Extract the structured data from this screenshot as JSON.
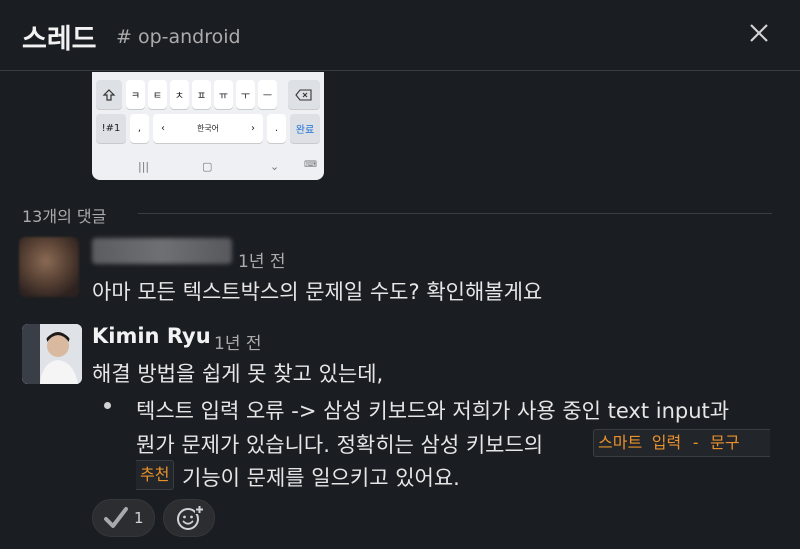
{
  "header": {
    "title": "스레드",
    "channel": "# op-android",
    "close_icon": "close-icon"
  },
  "keyboard": {
    "row1": [
      "ㅋ",
      "ㅌ",
      "ㅊ",
      "ㅍ",
      "ㅠ",
      "ㅜ",
      "ㅡ"
    ],
    "symbols_key": "!#1",
    "comma_key": ",",
    "lang_key": "한국어",
    "left_arrow": "‹",
    "right_arrow": "›",
    "period_key": ".",
    "done_key": "완료",
    "shift_icon": "shift-icon",
    "backspace_icon": "backspace-icon"
  },
  "thread": {
    "reply_count_label": "13개의 댓글"
  },
  "messages": [
    {
      "author": "",
      "time": "1년 전",
      "text": "아마 모든 텍스트박스의 문제일 수도? 확인해볼게요"
    },
    {
      "author": "Kimin Ryu",
      "time": "1년 전",
      "text": "해결 방법을 쉽게 못 찾고 있는데,",
      "bullet_line1": "텍스트 입력 오류 -> 삼성 키보드와 저희가 사용 중인 text input과",
      "bullet_line2_prefix": "뭔가 문제가 있습니다. 정확히는 삼성 키보드의",
      "code_part1": "스마트 입력 - 문구",
      "code_part2": "추천",
      "bullet_line3_suffix": "기능이 문제를 일으키고 있어요.",
      "reactions": [
        {
          "emoji_icon": "checkmark-icon",
          "count": "1"
        }
      ],
      "add_reaction_icon": "add-reaction-icon"
    }
  ],
  "colors": {
    "background": "#1a1d21",
    "code_text": "#e8912d",
    "muted": "#ababad"
  }
}
